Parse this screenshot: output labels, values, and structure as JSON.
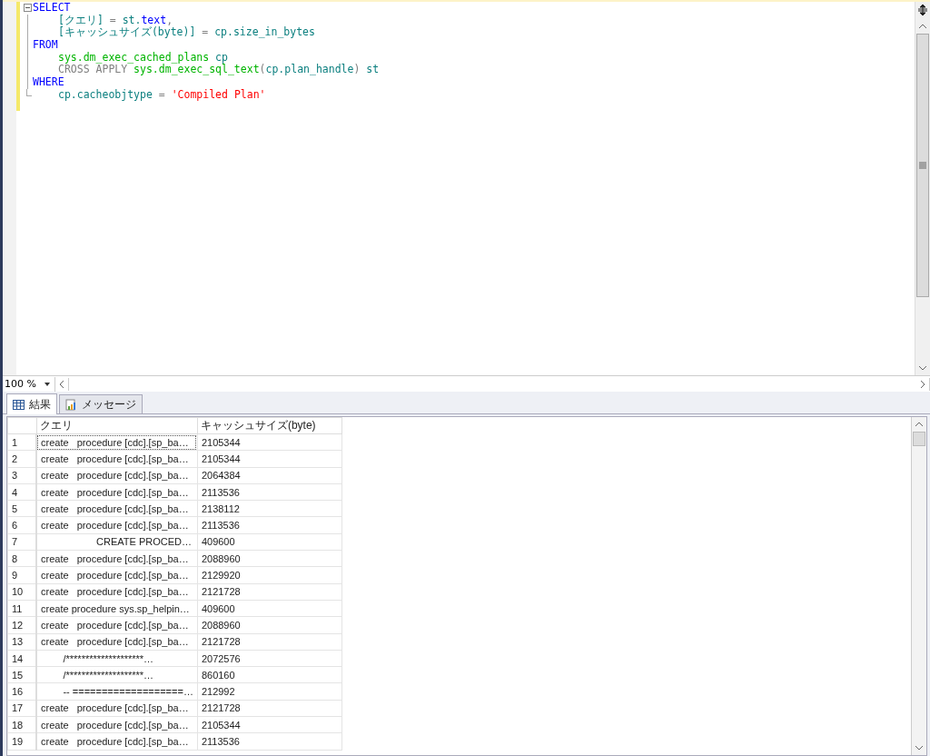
{
  "editor": {
    "blocks": [
      {
        "tokens": [
          {
            "kind": "keyword",
            "text": "SELECT"
          }
        ],
        "children": [
          {
            "tokens": [
              {
                "kind": "ident",
                "text": "[クエリ]"
              },
              {
                "kind": "gray",
                "text": " = "
              },
              {
                "kind": "ident",
                "text": "st."
              },
              {
                "kind": "keyword",
                "text": "text"
              },
              {
                "kind": "gray",
                "text": ","
              }
            ]
          },
          {
            "tokens": [
              {
                "kind": "ident",
                "text": "[キャッシュサイズ(byte)]"
              },
              {
                "kind": "gray",
                "text": " = "
              },
              {
                "kind": "ident",
                "text": "cp.size_in_bytes"
              }
            ]
          }
        ]
      },
      {
        "tokens": [
          {
            "kind": "keyword",
            "text": "FROM"
          }
        ],
        "children": [
          {
            "tokens": [
              {
                "kind": "function",
                "text": "sys.dm_exec_cached_plans"
              },
              {
                "kind": "ident",
                "text": " cp"
              }
            ]
          },
          {
            "tokens": [
              {
                "kind": "gray",
                "text": "CROSS APPLY "
              },
              {
                "kind": "function",
                "text": "sys.dm_exec_sql_text"
              },
              {
                "kind": "gray",
                "text": "("
              },
              {
                "kind": "ident",
                "text": "cp.plan_handle"
              },
              {
                "kind": "gray",
                "text": ")"
              },
              {
                "kind": "ident",
                "text": " st"
              }
            ]
          }
        ]
      },
      {
        "tokens": [
          {
            "kind": "keyword",
            "text": "WHERE"
          }
        ],
        "children": [
          {
            "tokens": [
              {
                "kind": "ident",
                "text": "cp.cacheobjtype"
              },
              {
                "kind": "gray",
                "text": " = "
              },
              {
                "kind": "string",
                "text": "'Compiled Plan'"
              }
            ]
          }
        ]
      }
    ]
  },
  "zoom": "100 %",
  "tabs": [
    {
      "label": "結果",
      "selected": true,
      "kind": "grid"
    },
    {
      "label": "メッセージ",
      "selected": false,
      "kind": "messages"
    }
  ],
  "grid": {
    "columns": [
      "クエリ",
      "キャッシュサイズ(byte)"
    ],
    "rows": [
      {
        "num": "1",
        "query": "create   procedure [cdc].[sp_ba…",
        "size": "2105344",
        "focused": true
      },
      {
        "num": "2",
        "query": "create   procedure [cdc].[sp_ba…",
        "size": "2105344",
        "focused": false
      },
      {
        "num": "3",
        "query": "create   procedure [cdc].[sp_ba…",
        "size": "2064384",
        "focused": false
      },
      {
        "num": "4",
        "query": "create   procedure [cdc].[sp_ba…",
        "size": "2113536",
        "focused": false
      },
      {
        "num": "5",
        "query": "create   procedure [cdc].[sp_ba…",
        "size": "2138112",
        "focused": false
      },
      {
        "num": "6",
        "query": "create   procedure [cdc].[sp_ba…",
        "size": "2113536",
        "focused": false
      },
      {
        "num": "7",
        "query": "                    CREATE PROCED…",
        "size": "409600",
        "focused": false
      },
      {
        "num": "8",
        "query": "create   procedure [cdc].[sp_ba…",
        "size": "2088960",
        "focused": false
      },
      {
        "num": "9",
        "query": "create   procedure [cdc].[sp_ba…",
        "size": "2129920",
        "focused": false
      },
      {
        "num": "10",
        "query": "create   procedure [cdc].[sp_ba…",
        "size": "2121728",
        "focused": false
      },
      {
        "num": "11",
        "query": "create procedure sys.sp_helpin…",
        "size": "409600",
        "focused": false
      },
      {
        "num": "12",
        "query": "create   procedure [cdc].[sp_ba…",
        "size": "2088960",
        "focused": false
      },
      {
        "num": "13",
        "query": "create   procedure [cdc].[sp_ba…",
        "size": "2121728",
        "focused": false
      },
      {
        "num": "14",
        "query": "        /********************…",
        "size": "2072576",
        "focused": false
      },
      {
        "num": "15",
        "query": "        /********************…",
        "size": "860160",
        "focused": false
      },
      {
        "num": "16",
        "query": "        -- ===================…",
        "size": "212992",
        "focused": false
      },
      {
        "num": "17",
        "query": "create   procedure [cdc].[sp_ba…",
        "size": "2121728",
        "focused": false
      },
      {
        "num": "18",
        "query": "create   procedure [cdc].[sp_ba…",
        "size": "2105344",
        "focused": false
      },
      {
        "num": "19",
        "query": "create   procedure [cdc].[sp_ba…",
        "size": "2113536",
        "focused": false
      }
    ]
  }
}
